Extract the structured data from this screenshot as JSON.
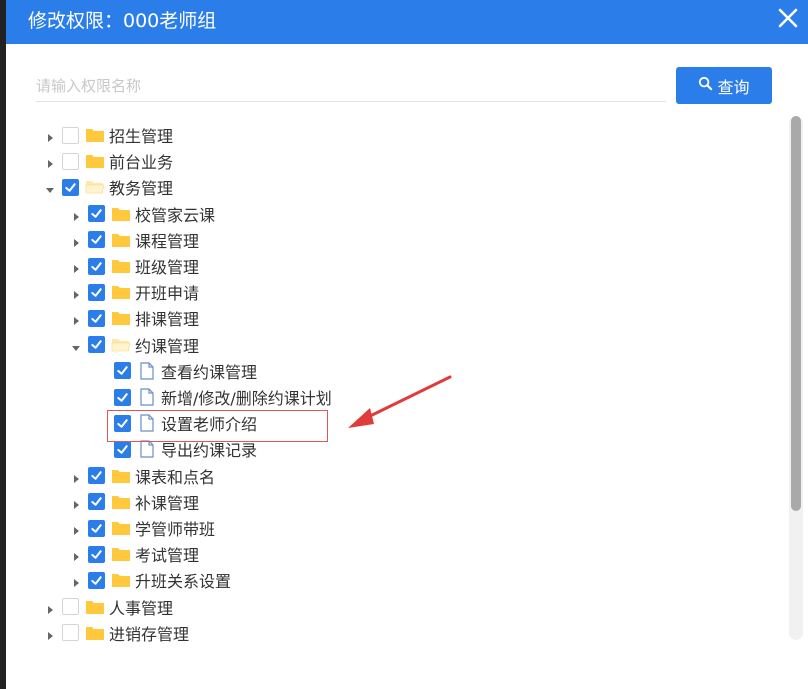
{
  "dialog": {
    "title": "修改权限：000老师组"
  },
  "search": {
    "placeholder": "请输入权限名称",
    "value": "",
    "button_label": "查询"
  },
  "colors": {
    "accent": "#2b7de9",
    "folder": "#ffc83d",
    "highlight": "#e05757"
  },
  "tree": [
    {
      "label": "招生管理",
      "level": 0,
      "type": "folder",
      "expanded": false,
      "checked": false
    },
    {
      "label": "前台业务",
      "level": 0,
      "type": "folder",
      "expanded": false,
      "checked": false
    },
    {
      "label": "教务管理",
      "level": 0,
      "type": "folder",
      "expanded": true,
      "checked": true
    },
    {
      "label": "校管家云课",
      "level": 1,
      "type": "folder",
      "expanded": false,
      "checked": true
    },
    {
      "label": "课程管理",
      "level": 1,
      "type": "folder",
      "expanded": false,
      "checked": true
    },
    {
      "label": "班级管理",
      "level": 1,
      "type": "folder",
      "expanded": false,
      "checked": true
    },
    {
      "label": "开班申请",
      "level": 1,
      "type": "folder",
      "expanded": false,
      "checked": true
    },
    {
      "label": "排课管理",
      "level": 1,
      "type": "folder",
      "expanded": false,
      "checked": true
    },
    {
      "label": "约课管理",
      "level": 1,
      "type": "folder",
      "expanded": true,
      "checked": true
    },
    {
      "label": "查看约课管理",
      "level": 2,
      "type": "file",
      "checked": true
    },
    {
      "label": "新增/修改/删除约课计划",
      "level": 2,
      "type": "file",
      "checked": true
    },
    {
      "label": "设置老师介绍",
      "level": 2,
      "type": "file",
      "checked": true
    },
    {
      "label": "导出约课记录",
      "level": 2,
      "type": "file",
      "checked": true
    },
    {
      "label": "课表和点名",
      "level": 1,
      "type": "folder",
      "expanded": false,
      "checked": true
    },
    {
      "label": "补课管理",
      "level": 1,
      "type": "folder",
      "expanded": false,
      "checked": true
    },
    {
      "label": "学管师带班",
      "level": 1,
      "type": "folder",
      "expanded": false,
      "checked": true
    },
    {
      "label": "考试管理",
      "level": 1,
      "type": "folder",
      "expanded": false,
      "checked": true
    },
    {
      "label": "升班关系设置",
      "level": 1,
      "type": "folder",
      "expanded": false,
      "checked": true
    },
    {
      "label": "人事管理",
      "level": 0,
      "type": "folder",
      "expanded": false,
      "checked": false
    },
    {
      "label": "进销存管理",
      "level": 0,
      "type": "folder",
      "expanded": false,
      "checked": false
    }
  ]
}
